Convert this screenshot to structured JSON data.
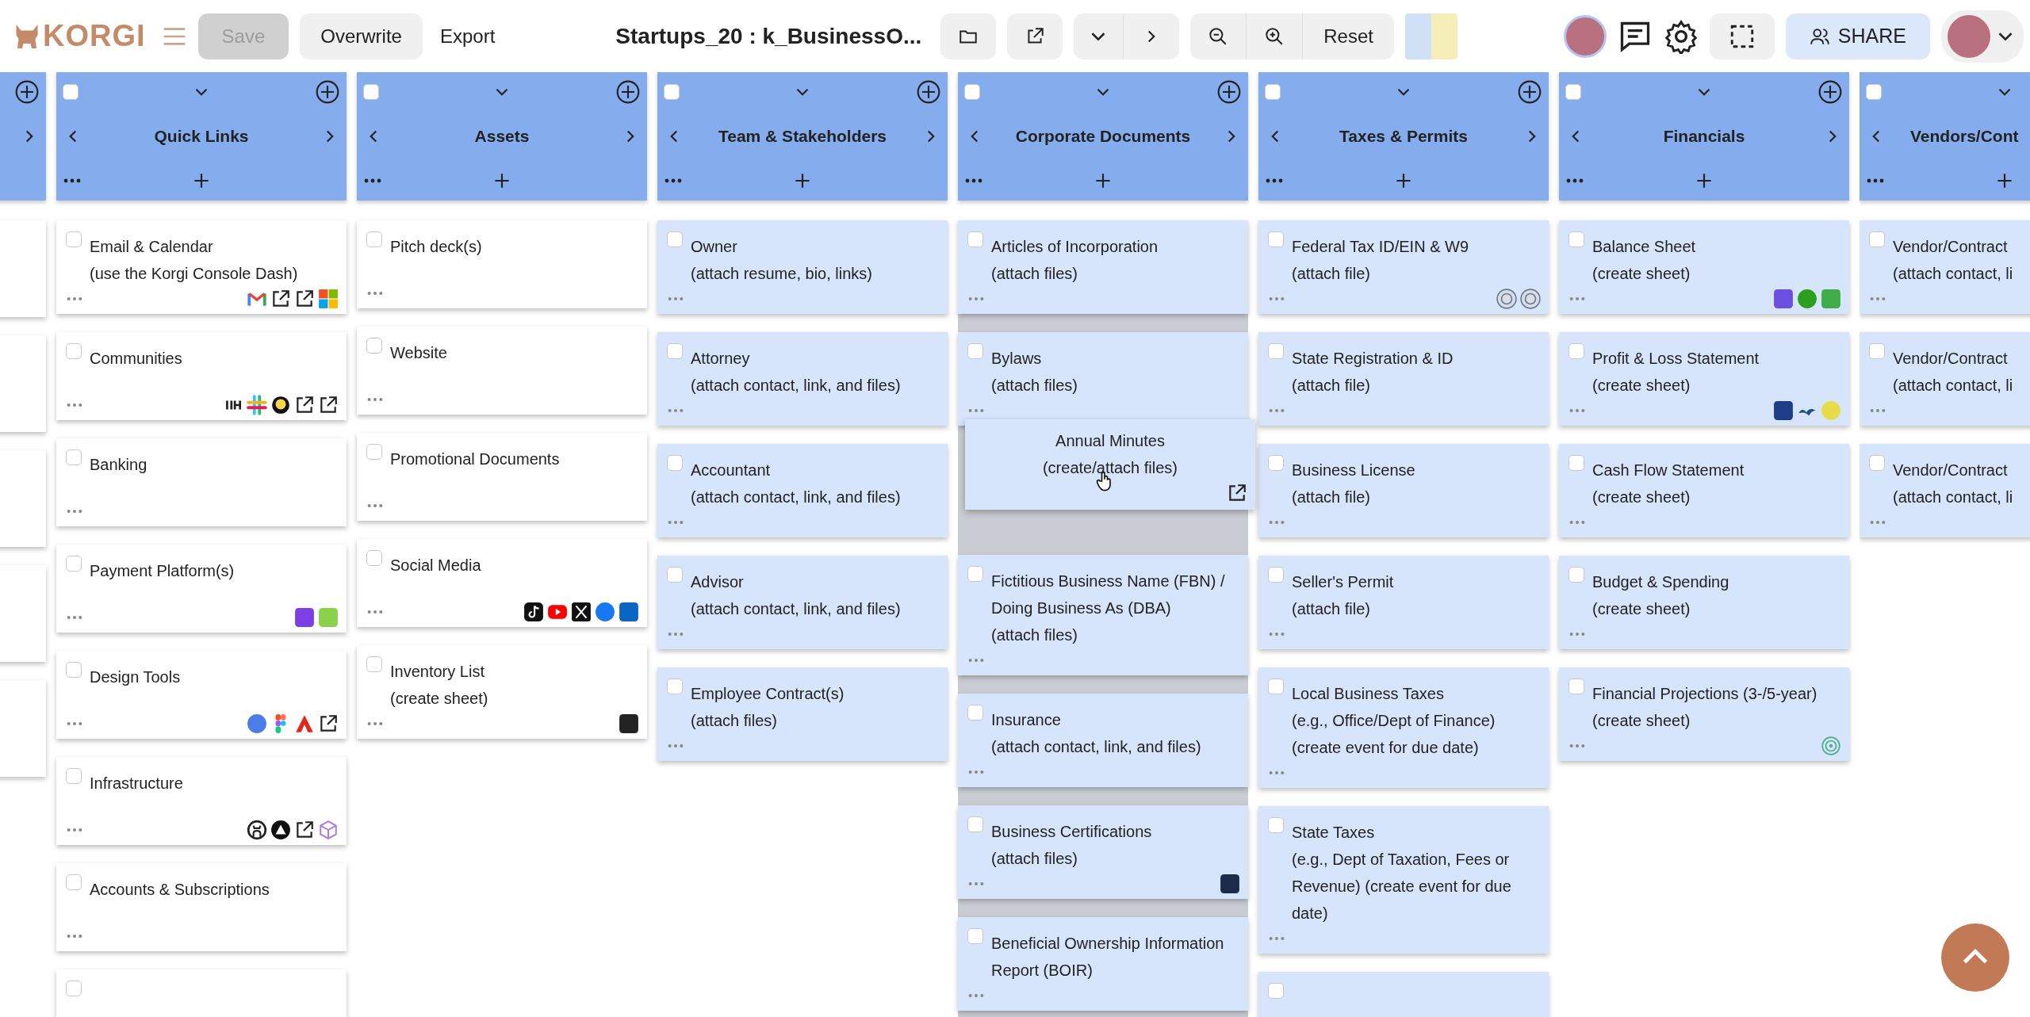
{
  "toolbar": {
    "logo": "KORGI",
    "save": {
      "label": "Save",
      "disabled": true
    },
    "overwrite": "Overwrite",
    "export": "Export",
    "title": "Startups_20 : k_BusinessO...",
    "reset": "Reset",
    "share": "SHARE"
  },
  "columns": [
    {
      "kind": "partial",
      "color": "#ffffff",
      "drop_target": false,
      "cards": [
        {
          "kind": "stub"
        },
        {
          "kind": "stub"
        },
        {
          "kind": "stub"
        },
        {
          "kind": "stub"
        },
        {
          "kind": "stub"
        }
      ]
    },
    {
      "kind": "full",
      "title": "Quick Links",
      "checked": false,
      "color": "#ffffff",
      "drop_target": false,
      "cards": [
        {
          "kind": "card",
          "title": "Email & Calendar",
          "subtitle": "(use the Korgi Console Dash)",
          "checked": false
        },
        {
          "kind": "card",
          "title": "Communities",
          "checked": false
        },
        {
          "kind": "card",
          "title": "Banking",
          "checked": false
        },
        {
          "kind": "card",
          "title": "Payment Platform(s)",
          "checked": false
        },
        {
          "kind": "card",
          "title": "Design Tools",
          "checked": false
        },
        {
          "kind": "card",
          "title": "Infrastructure",
          "checked": false
        },
        {
          "kind": "card",
          "title": "Accounts & Subscriptions",
          "checked": false
        },
        {
          "kind": "stub",
          "checked": false
        }
      ]
    },
    {
      "kind": "full",
      "title": "Assets",
      "checked": false,
      "color": "#ffffff",
      "drop_target": false,
      "cards": [
        {
          "kind": "card",
          "title": "Pitch deck(s)",
          "checked": false
        },
        {
          "kind": "card",
          "title": "Website",
          "checked": false
        },
        {
          "kind": "card",
          "title": "Promotional Documents",
          "checked": false
        },
        {
          "kind": "card",
          "title": "Social Media",
          "checked": false
        },
        {
          "kind": "card",
          "title": "Inventory List",
          "subtitle": "(create sheet)",
          "checked": false
        }
      ]
    },
    {
      "kind": "full",
      "title": "Team & Stakeholders",
      "checked": false,
      "color": "#d6e4fc",
      "drop_target": false,
      "cards": [
        {
          "kind": "card",
          "title": "Owner",
          "subtitle": "(attach resume, bio, links)",
          "checked": false
        },
        {
          "kind": "card",
          "title": "Attorney",
          "subtitle": "(attach contact, link, and files)",
          "checked": false
        },
        {
          "kind": "card",
          "title": "Accountant",
          "subtitle": "(attach contact, link, and files)",
          "checked": false
        },
        {
          "kind": "card",
          "title": "Advisor",
          "subtitle": "(attach contact, link, and files)",
          "checked": false
        },
        {
          "kind": "card",
          "title": "Employee Contract(s)",
          "subtitle": "(attach files)",
          "checked": false
        }
      ]
    },
    {
      "kind": "full",
      "title": "Corporate Documents",
      "checked": false,
      "color": "#d6e4fc",
      "drop_target": true,
      "cards": [
        {
          "kind": "card",
          "title": "Articles of Incorporation",
          "subtitle": "(attach files)",
          "checked": false
        },
        {
          "kind": "card",
          "title": "Bylaws",
          "subtitle": "(attach files)",
          "checked": false
        },
        {
          "kind": "dragging",
          "title": "Annual Minutes",
          "subtitle": "(create/attach files)"
        },
        {
          "kind": "card",
          "title": "Fictitious Business Name (FBN) / Doing Business As (DBA)",
          "subtitle": "(attach files)",
          "checked": false
        },
        {
          "kind": "card",
          "title": "Insurance",
          "subtitle": "(attach contact, link, and files)",
          "checked": false
        },
        {
          "kind": "card",
          "title": "Business Certifications",
          "subtitle": "(attach files)",
          "checked": false
        },
        {
          "kind": "card",
          "title": "Beneficial Ownership Information Report (BOIR)",
          "checked": false
        }
      ]
    },
    {
      "kind": "full",
      "title": "Taxes & Permits",
      "checked": false,
      "color": "#d6e4fc",
      "drop_target": false,
      "cards": [
        {
          "kind": "card",
          "title": "Federal Tax ID/EIN & W9",
          "subtitle": "(attach file)",
          "checked": false
        },
        {
          "kind": "card",
          "title": "State Registration & ID",
          "subtitle": "(attach file)",
          "checked": false
        },
        {
          "kind": "card",
          "title": "Business License",
          "subtitle": "(attach file)",
          "checked": false
        },
        {
          "kind": "card",
          "title": "Seller's Permit",
          "subtitle": "(attach file)",
          "checked": false
        },
        {
          "kind": "card",
          "title": "Local Business Taxes",
          "subtitle": "(e.g., Office/Dept of Finance) (create event for due date)",
          "checked": false
        },
        {
          "kind": "card",
          "title": "State Taxes",
          "subtitle": "(e.g., Dept of Taxation, Fees or Revenue) (create event for due date)",
          "checked": false
        },
        {
          "kind": "stub",
          "checked": false
        }
      ]
    },
    {
      "kind": "full",
      "title": "Financials",
      "checked": false,
      "color": "#d6e4fc",
      "drop_target": false,
      "cards": [
        {
          "kind": "card",
          "title": "Balance Sheet",
          "subtitle": "(create sheet)",
          "checked": false
        },
        {
          "kind": "card",
          "title": "Profit & Loss Statement",
          "subtitle": "(create sheet)",
          "checked": false
        },
        {
          "kind": "card",
          "title": "Cash Flow Statement",
          "subtitle": "(create sheet)",
          "checked": false
        },
        {
          "kind": "card",
          "title": "Budget & Spending",
          "subtitle": "(create sheet)",
          "checked": false
        },
        {
          "kind": "card",
          "title": "Financial Projections (3-/5-year)",
          "subtitle": "(create sheet)",
          "checked": false
        }
      ]
    },
    {
      "kind": "cut",
      "title": "Vendors/Cont",
      "checked": false,
      "color": "#d6e4fc",
      "drop_target": false,
      "cards": [
        {
          "kind": "card",
          "title": "Vendor/Contract",
          "subtitle": "(attach contact, li",
          "checked": false
        },
        {
          "kind": "card",
          "title": "Vendor/Contract",
          "subtitle": "(attach contact, li",
          "checked": false
        },
        {
          "kind": "card",
          "title": "Vendor/Contract",
          "subtitle": "(attach contact, li",
          "checked": false
        }
      ]
    }
  ]
}
